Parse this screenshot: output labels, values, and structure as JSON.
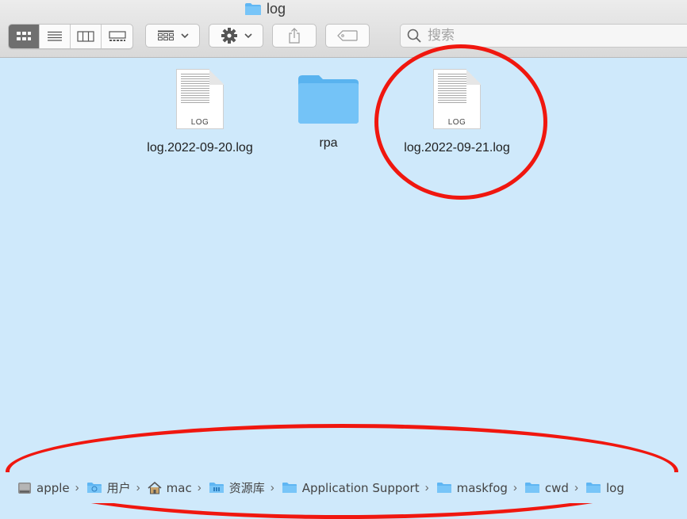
{
  "window": {
    "title": "log"
  },
  "toolbar": {
    "view_buttons": [
      "icon-view",
      "list-view",
      "column-view",
      "gallery-view"
    ],
    "search_placeholder": "搜索"
  },
  "files": [
    {
      "name": "log.2022-09-20.log",
      "kind": "document",
      "ext_label": "LOG"
    },
    {
      "name": "rpa",
      "kind": "folder"
    },
    {
      "name": "log.2022-09-21.log",
      "kind": "document",
      "ext_label": "LOG"
    }
  ],
  "path_bar": [
    {
      "label": "apple",
      "icon": "disk-icon"
    },
    {
      "label": "用户",
      "icon": "users-folder-icon"
    },
    {
      "label": "mac",
      "icon": "home-icon"
    },
    {
      "label": "资源库",
      "icon": "library-folder-icon"
    },
    {
      "label": "Application Support",
      "icon": "folder-icon"
    },
    {
      "label": "maskfog",
      "icon": "folder-icon"
    },
    {
      "label": "cwd",
      "icon": "folder-icon"
    },
    {
      "label": "log",
      "icon": "folder-icon"
    }
  ],
  "colors": {
    "background": "#cfe9fb",
    "folder": "#68bdf6",
    "annotation": "#f0170f"
  }
}
